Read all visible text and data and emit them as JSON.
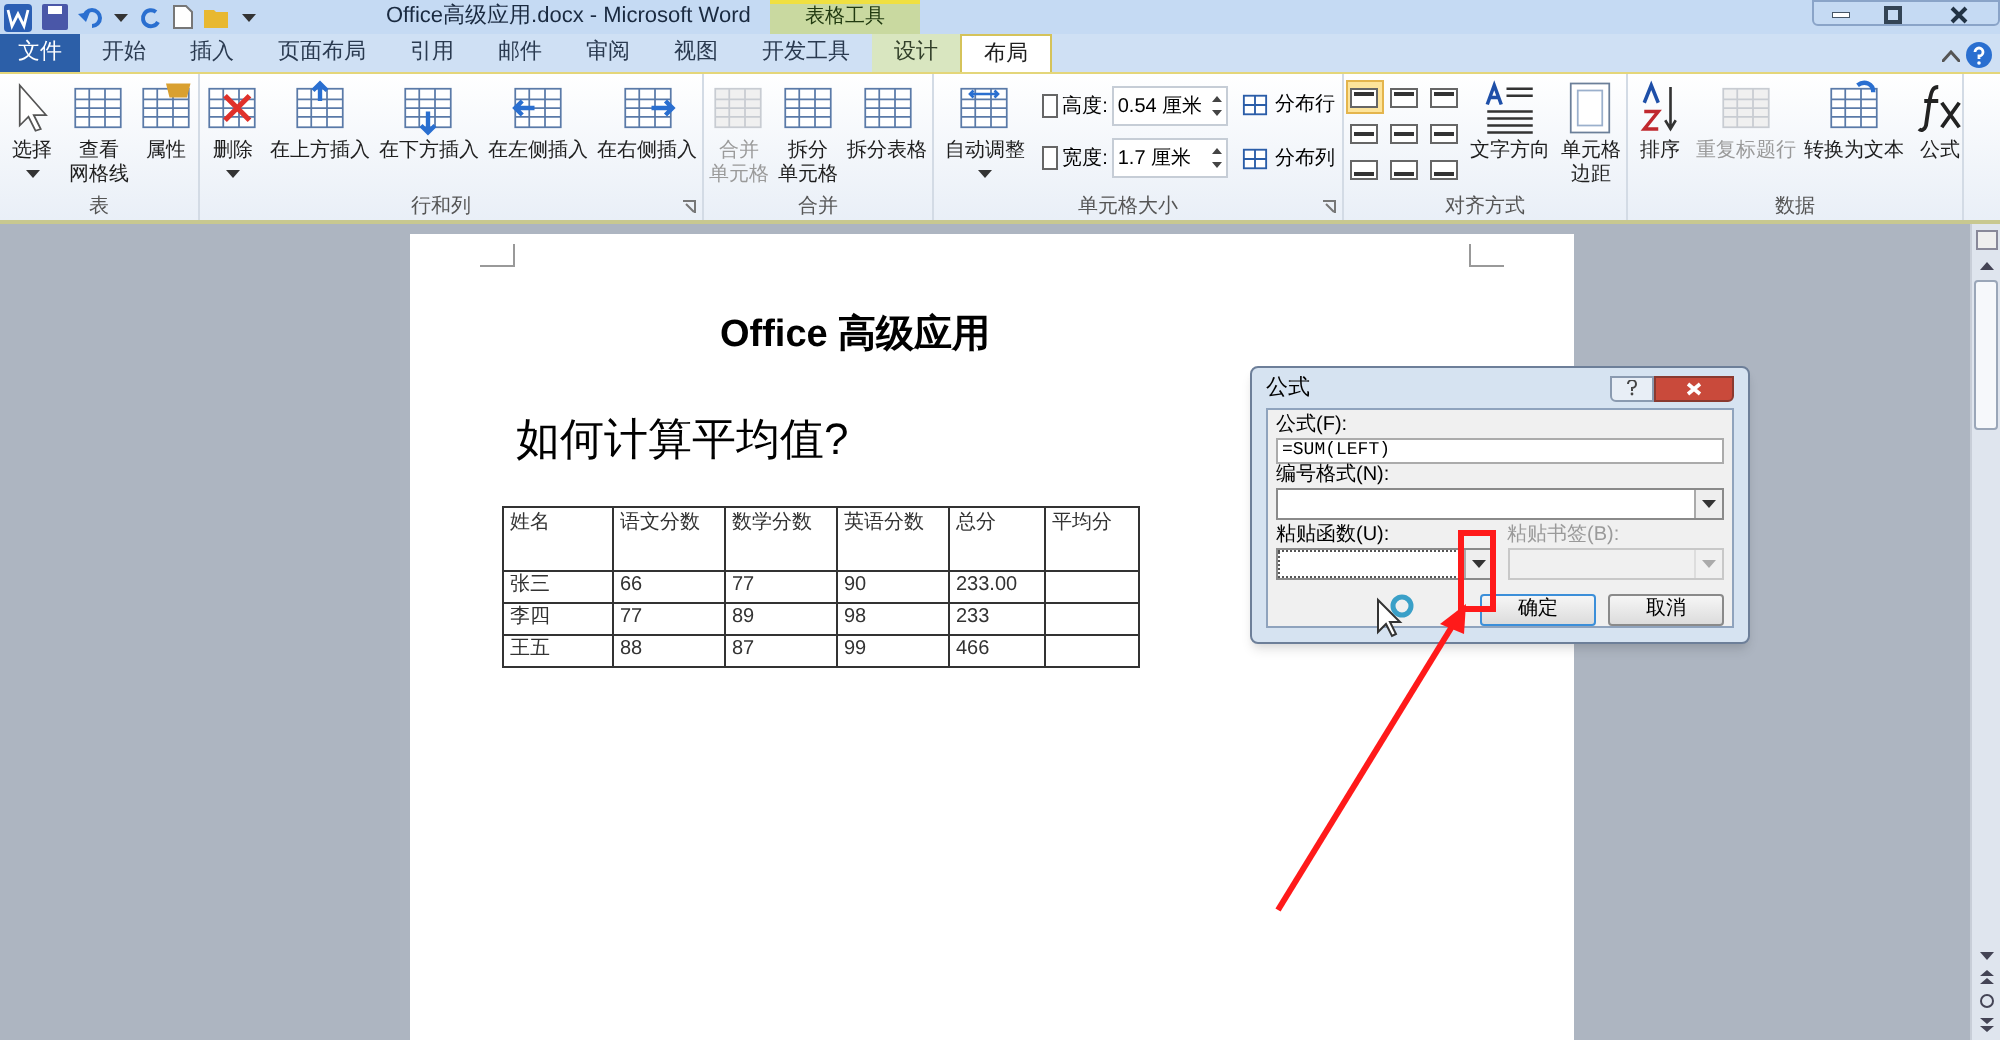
{
  "window": {
    "title": "Office高级应用.docx  -  Microsoft Word",
    "contextual_group": "表格工具"
  },
  "tabs": [
    {
      "label": "文件",
      "kind": "file",
      "selected": false
    },
    {
      "label": "开始",
      "kind": "normal",
      "selected": false
    },
    {
      "label": "插入",
      "kind": "normal",
      "selected": false
    },
    {
      "label": "页面布局",
      "kind": "normal",
      "selected": false
    },
    {
      "label": "引用",
      "kind": "normal",
      "selected": false
    },
    {
      "label": "邮件",
      "kind": "normal",
      "selected": false
    },
    {
      "label": "审阅",
      "kind": "normal",
      "selected": false
    },
    {
      "label": "视图",
      "kind": "normal",
      "selected": false
    },
    {
      "label": "开发工具",
      "kind": "normal",
      "selected": false
    },
    {
      "label": "设计",
      "kind": "contextual",
      "selected": false
    },
    {
      "label": "布局",
      "kind": "contextual",
      "selected": true
    }
  ],
  "ribbon": {
    "groups": [
      {
        "label": "表",
        "launcher": false,
        "items": [
          {
            "kind": "large",
            "lines": [
              "选择"
            ],
            "dropdown": true,
            "disabled": false
          },
          {
            "kind": "large",
            "lines": [
              "查看",
              "网格线"
            ],
            "dropdown": false,
            "disabled": false
          },
          {
            "kind": "large",
            "lines": [
              "属性"
            ],
            "dropdown": false,
            "disabled": false
          }
        ]
      },
      {
        "label": "行和列",
        "launcher": true,
        "items": [
          {
            "kind": "large",
            "lines": [
              "删除"
            ],
            "dropdown": true,
            "disabled": false
          },
          {
            "kind": "large",
            "lines": [
              "在上方插入"
            ],
            "dropdown": false,
            "disabled": false
          },
          {
            "kind": "large",
            "lines": [
              "在下方插入"
            ],
            "dropdown": false,
            "disabled": false
          },
          {
            "kind": "large",
            "lines": [
              "在左侧插入"
            ],
            "dropdown": false,
            "disabled": false
          },
          {
            "kind": "large",
            "lines": [
              "在右侧插入"
            ],
            "dropdown": false,
            "disabled": false
          }
        ]
      },
      {
        "label": "合并",
        "launcher": false,
        "items": [
          {
            "kind": "large",
            "lines": [
              "合并",
              "单元格"
            ],
            "dropdown": false,
            "disabled": true
          },
          {
            "kind": "large",
            "lines": [
              "拆分",
              "单元格"
            ],
            "dropdown": false,
            "disabled": false
          },
          {
            "kind": "large",
            "lines": [
              "拆分表格"
            ],
            "dropdown": false,
            "disabled": false
          }
        ]
      },
      {
        "label": "单元格大小",
        "launcher": true,
        "items": [
          {
            "kind": "large",
            "lines": [
              "自动调整"
            ],
            "dropdown": true,
            "disabled": false
          },
          {
            "kind": "fields",
            "rows": [
              {
                "label": "高度:",
                "value": "0.54 厘米"
              },
              {
                "label": "宽度:",
                "value": "1.7 厘米"
              }
            ]
          },
          {
            "kind": "small",
            "rows": [
              {
                "label": "分布行"
              },
              {
                "label": "分布列"
              }
            ]
          }
        ]
      },
      {
        "label": "对齐方式",
        "launcher": false,
        "items": [
          {
            "kind": "align",
            "cells": [
              {
                "selected": true
              },
              {
                "selected": false
              },
              {
                "selected": false
              },
              {
                "selected": false
              },
              {
                "selected": false
              },
              {
                "selected": false
              },
              {
                "selected": false
              },
              {
                "selected": false
              },
              {
                "selected": false
              }
            ]
          },
          {
            "kind": "large",
            "lines": [
              "文字方向"
            ],
            "dropdown": false,
            "disabled": false
          },
          {
            "kind": "large",
            "lines": [
              "单元格",
              "边距"
            ],
            "dropdown": false,
            "disabled": false
          }
        ]
      },
      {
        "label": "数据",
        "launcher": false,
        "items": [
          {
            "kind": "large",
            "lines": [
              "排序"
            ],
            "dropdown": false,
            "disabled": false
          },
          {
            "kind": "large",
            "lines": [
              "重复标题行"
            ],
            "dropdown": false,
            "disabled": true
          },
          {
            "kind": "large",
            "lines": [
              "转换为文本"
            ],
            "dropdown": false,
            "disabled": false
          },
          {
            "kind": "large",
            "lines": [
              "公式"
            ],
            "dropdown": false,
            "disabled": false
          }
        ]
      }
    ]
  },
  "document": {
    "heading": "Office 高级应用",
    "question": "如何计算平均值?",
    "table": {
      "columns": [
        "姓名",
        "语文分数",
        "数学分数",
        "英语分数",
        "总分",
        "平均分"
      ],
      "rows": [
        [
          "张三",
          "66",
          "77",
          "90",
          "233.00",
          ""
        ],
        [
          "李四",
          "77",
          "89",
          "98",
          "233",
          ""
        ],
        [
          "王五",
          "88",
          "87",
          "99",
          "466",
          ""
        ]
      ]
    }
  },
  "dialog": {
    "title": "公式",
    "fields": [
      {
        "label": "公式(F):",
        "value": "=SUM(LEFT)",
        "kind": "text",
        "disabled": false
      },
      {
        "label": "编号格式(N):",
        "kind": "combo",
        "disabled": false
      }
    ],
    "pair": [
      {
        "label": "粘贴函数(U):",
        "disabled": false
      },
      {
        "label": "粘贴书签(B):",
        "disabled": true
      }
    ],
    "buttons": [
      {
        "label": "确定",
        "default": true
      },
      {
        "label": "取消",
        "default": false
      }
    ]
  }
}
